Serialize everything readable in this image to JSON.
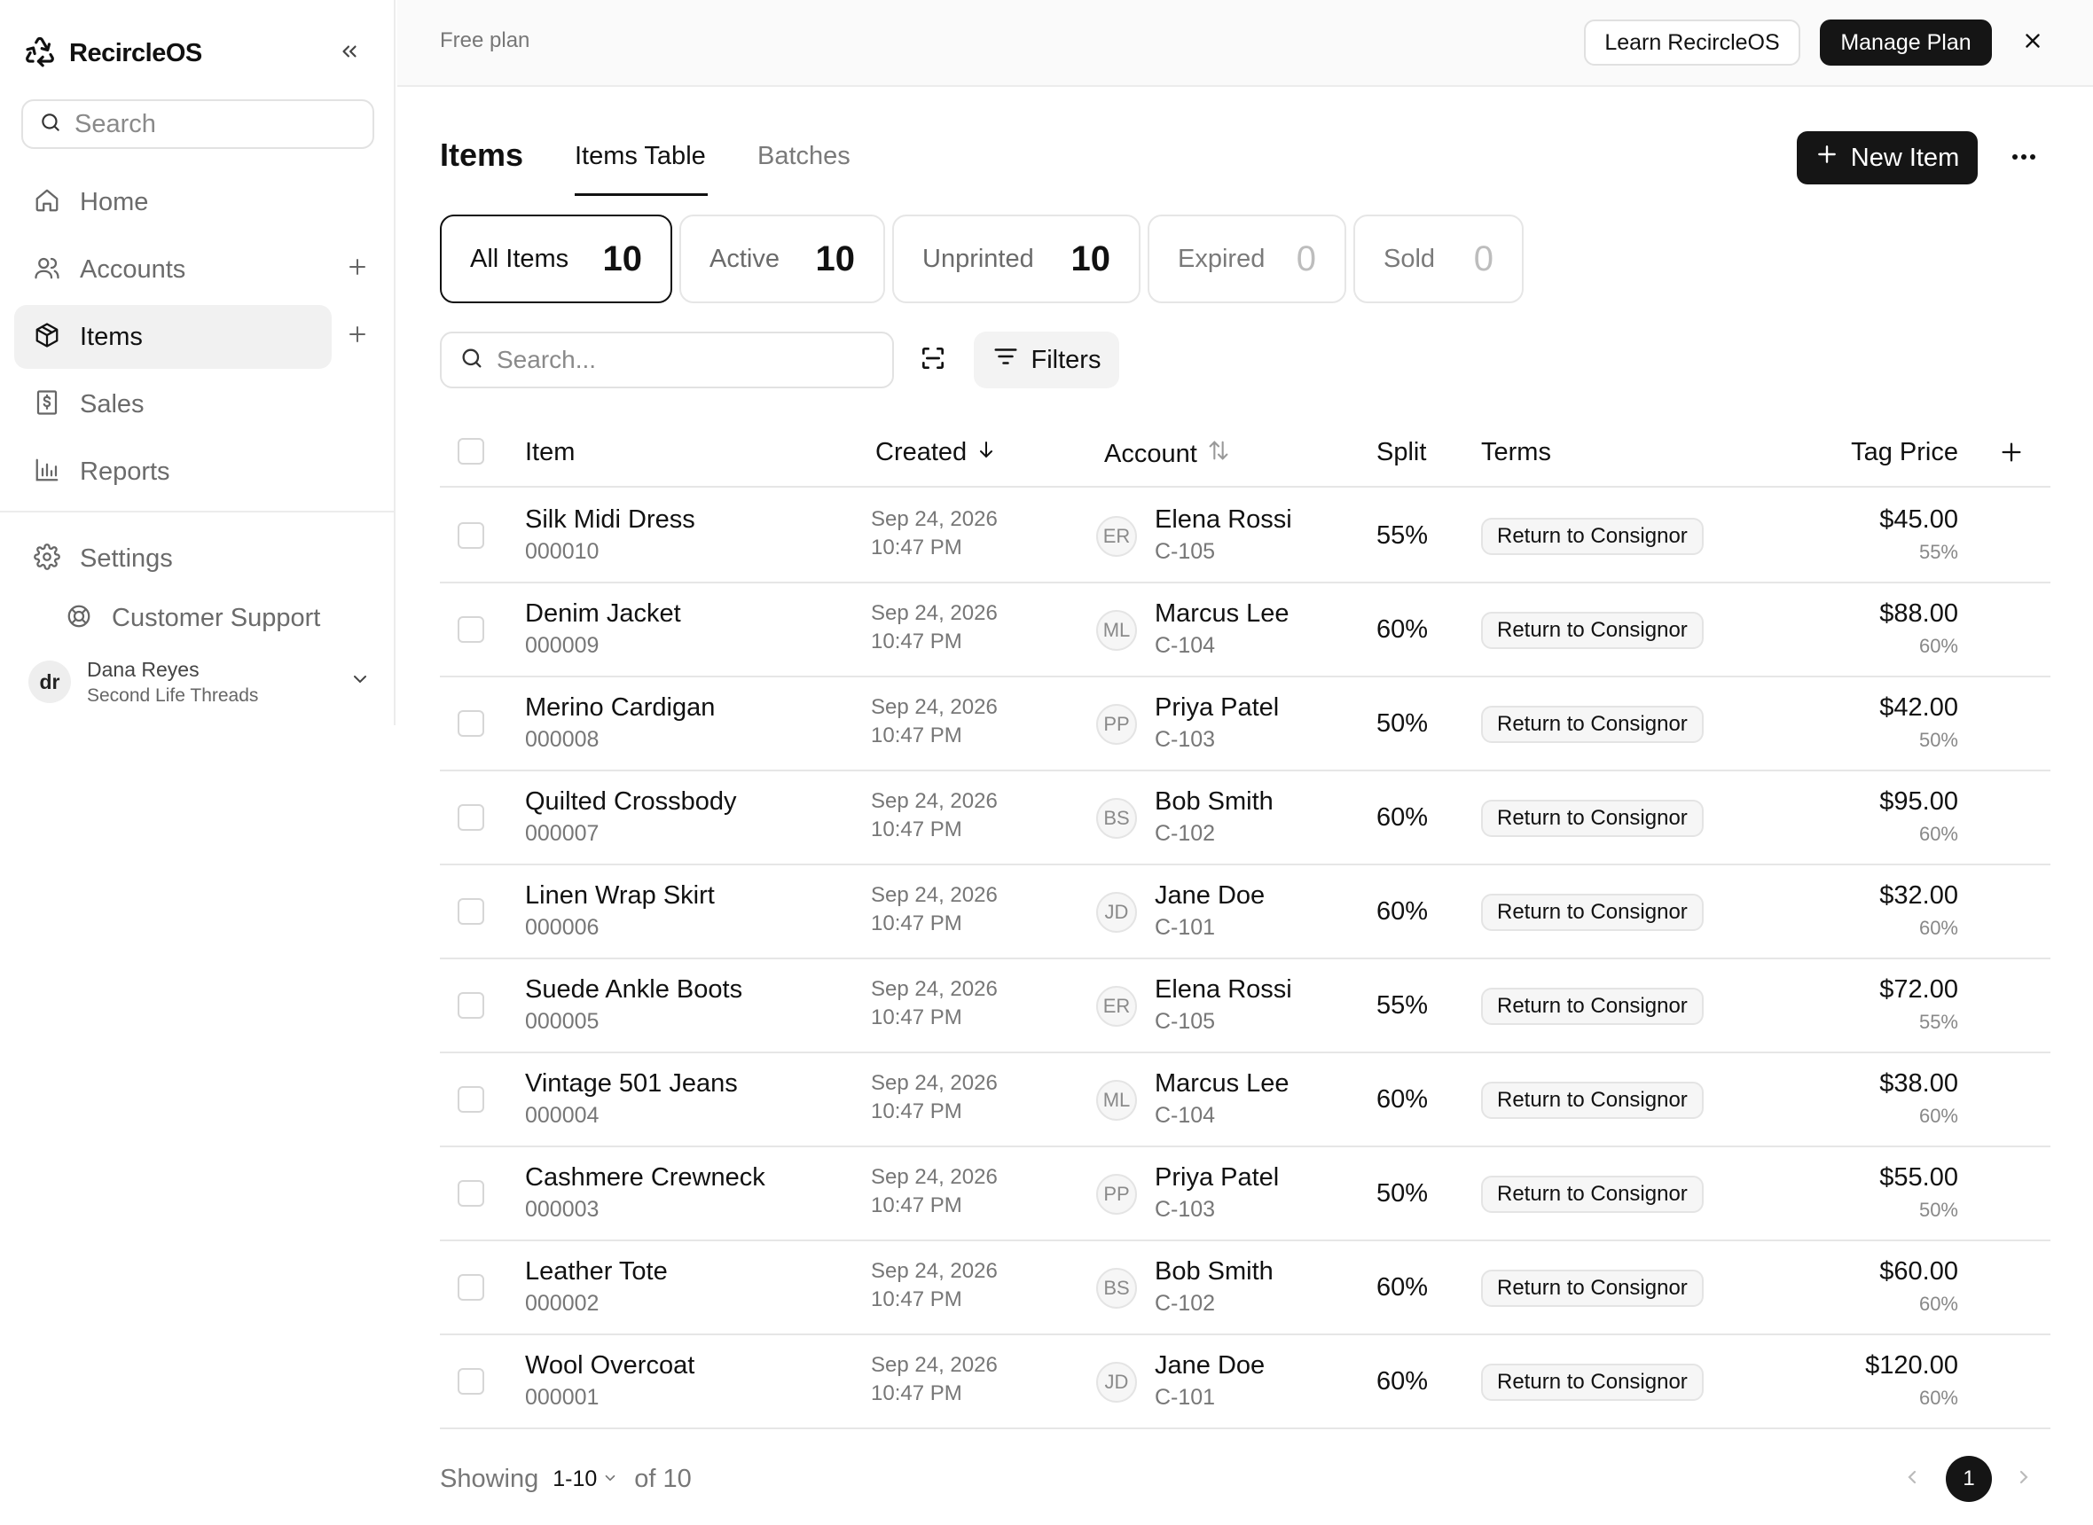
{
  "app": {
    "name": "RecircleOS"
  },
  "sidebar": {
    "search_placeholder": "Search",
    "nav": [
      {
        "label": "Home",
        "icon": "home-icon"
      },
      {
        "label": "Accounts",
        "icon": "users-icon"
      },
      {
        "label": "Items",
        "icon": "box-icon"
      },
      {
        "label": "Sales",
        "icon": "receipt-icon"
      },
      {
        "label": "Reports",
        "icon": "bar-chart-icon"
      },
      {
        "label": "Settings",
        "icon": "gear-icon"
      }
    ],
    "support_label": "Customer Support",
    "user": {
      "initials": "dr",
      "name": "Dana Reyes",
      "org": "Second Life Threads"
    }
  },
  "topbar": {
    "plan": "Free plan",
    "learn_label": "Learn RecircleOS",
    "manage_label": "Manage Plan"
  },
  "page": {
    "title": "Items",
    "tabs": [
      {
        "label": "Items Table"
      },
      {
        "label": "Batches"
      }
    ],
    "new_item_label": "New Item"
  },
  "stats": [
    {
      "label": "All Items",
      "count": "10"
    },
    {
      "label": "Active",
      "count": "10"
    },
    {
      "label": "Unprinted",
      "count": "10"
    },
    {
      "label": "Expired",
      "count": "0"
    },
    {
      "label": "Sold",
      "count": "0"
    }
  ],
  "filters": {
    "search_placeholder": "Search...",
    "filters_label": "Filters"
  },
  "table": {
    "headers": {
      "item": "Item",
      "created": "Created",
      "account": "Account",
      "split": "Split",
      "terms": "Terms",
      "tag_price": "Tag Price"
    },
    "rows": [
      {
        "name": "Silk Midi Dress",
        "sku": "000010",
        "date": "Sep 24, 2026",
        "time": "10:47 PM",
        "initials": "ER",
        "account": "Elena Rossi",
        "account_id": "C-105",
        "split": "55%",
        "terms": "Return to Consignor",
        "price": "$45.00",
        "price_split": "55%"
      },
      {
        "name": "Denim Jacket",
        "sku": "000009",
        "date": "Sep 24, 2026",
        "time": "10:47 PM",
        "initials": "ML",
        "account": "Marcus Lee",
        "account_id": "C-104",
        "split": "60%",
        "terms": "Return to Consignor",
        "price": "$88.00",
        "price_split": "60%"
      },
      {
        "name": "Merino Cardigan",
        "sku": "000008",
        "date": "Sep 24, 2026",
        "time": "10:47 PM",
        "initials": "PP",
        "account": "Priya Patel",
        "account_id": "C-103",
        "split": "50%",
        "terms": "Return to Consignor",
        "price": "$42.00",
        "price_split": "50%"
      },
      {
        "name": "Quilted Crossbody",
        "sku": "000007",
        "date": "Sep 24, 2026",
        "time": "10:47 PM",
        "initials": "BS",
        "account": "Bob Smith",
        "account_id": "C-102",
        "split": "60%",
        "terms": "Return to Consignor",
        "price": "$95.00",
        "price_split": "60%"
      },
      {
        "name": "Linen Wrap Skirt",
        "sku": "000006",
        "date": "Sep 24, 2026",
        "time": "10:47 PM",
        "initials": "JD",
        "account": "Jane Doe",
        "account_id": "C-101",
        "split": "60%",
        "terms": "Return to Consignor",
        "price": "$32.00",
        "price_split": "60%"
      },
      {
        "name": "Suede Ankle Boots",
        "sku": "000005",
        "date": "Sep 24, 2026",
        "time": "10:47 PM",
        "initials": "ER",
        "account": "Elena Rossi",
        "account_id": "C-105",
        "split": "55%",
        "terms": "Return to Consignor",
        "price": "$72.00",
        "price_split": "55%"
      },
      {
        "name": "Vintage 501 Jeans",
        "sku": "000004",
        "date": "Sep 24, 2026",
        "time": "10:47 PM",
        "initials": "ML",
        "account": "Marcus Lee",
        "account_id": "C-104",
        "split": "60%",
        "terms": "Return to Consignor",
        "price": "$38.00",
        "price_split": "60%"
      },
      {
        "name": "Cashmere Crewneck",
        "sku": "000003",
        "date": "Sep 24, 2026",
        "time": "10:47 PM",
        "initials": "PP",
        "account": "Priya Patel",
        "account_id": "C-103",
        "split": "50%",
        "terms": "Return to Consignor",
        "price": "$55.00",
        "price_split": "50%"
      },
      {
        "name": "Leather Tote",
        "sku": "000002",
        "date": "Sep 24, 2026",
        "time": "10:47 PM",
        "initials": "BS",
        "account": "Bob Smith",
        "account_id": "C-102",
        "split": "60%",
        "terms": "Return to Consignor",
        "price": "$60.00",
        "price_split": "60%"
      },
      {
        "name": "Wool Overcoat",
        "sku": "000001",
        "date": "Sep 24, 2026",
        "time": "10:47 PM",
        "initials": "JD",
        "account": "Jane Doe",
        "account_id": "C-101",
        "split": "60%",
        "terms": "Return to Consignor",
        "price": "$120.00",
        "price_split": "60%"
      }
    ]
  },
  "pagination": {
    "showing_label": "Showing",
    "range": "1-10",
    "of_total": "of 10",
    "current_page": "1"
  }
}
